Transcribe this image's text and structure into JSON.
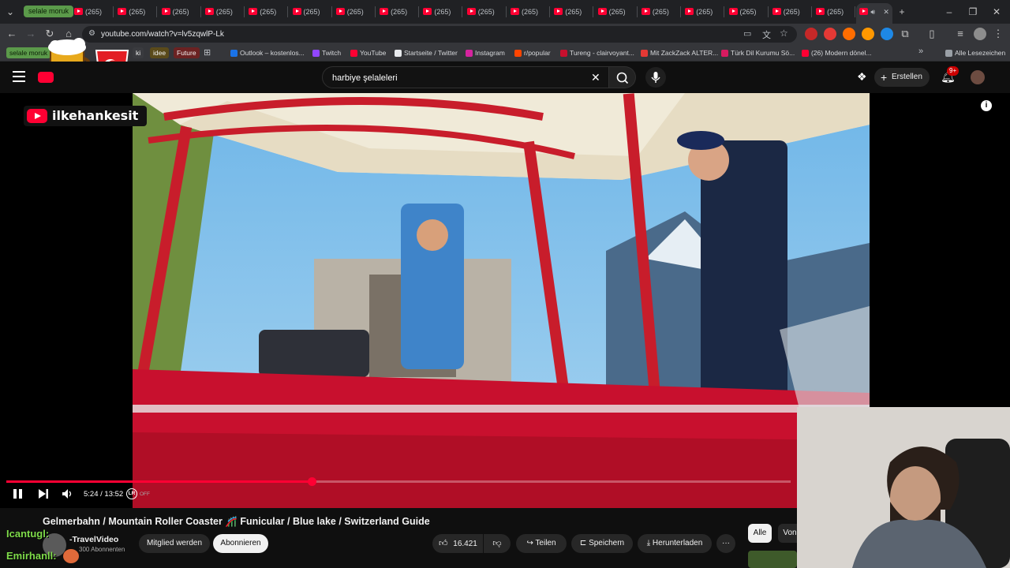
{
  "browser": {
    "tab_group_label": "selale moruk",
    "tabs": [
      {
        "label": "(265)"
      },
      {
        "label": "(265)"
      },
      {
        "label": "(265)"
      },
      {
        "label": "(265)"
      },
      {
        "label": "(265)"
      },
      {
        "label": "(265)"
      },
      {
        "label": "(265)"
      },
      {
        "label": "(265)"
      },
      {
        "label": "(265)"
      },
      {
        "label": "(265)"
      },
      {
        "label": "(265)"
      },
      {
        "label": "(265)"
      },
      {
        "label": "(265)"
      },
      {
        "label": "(265)"
      },
      {
        "label": "(265)"
      },
      {
        "label": "(265)"
      },
      {
        "label": "(265)"
      },
      {
        "label": "(265)"
      }
    ],
    "active_tab_index": 18,
    "url": "youtube.com/watch?v=lv5zqwlP-Lk",
    "bookmarks_group_chip": "selale moruk",
    "bookmark_chips": [
      {
        "label": "ki",
        "color": "#3a3b3f"
      },
      {
        "label": "idee",
        "color": "#5a4a1a"
      },
      {
        "label": "Future",
        "color": "#6b2222"
      }
    ],
    "bookmarks": [
      {
        "label": "Outlook – kostenlos...",
        "color": "#1a73e8"
      },
      {
        "label": "Twitch",
        "color": "#9146ff"
      },
      {
        "label": "YouTube",
        "color": "#ff0033"
      },
      {
        "label": "Startseite / Twitter",
        "color": "#e8eaed"
      },
      {
        "label": "Instagram",
        "color": "#d6249f"
      },
      {
        "label": "r/popular",
        "color": "#ff4500"
      },
      {
        "label": "Tureng - clairvoyant...",
        "color": "#c8102e"
      },
      {
        "label": "Mit ZackZack ALTER...",
        "color": "#e53935"
      },
      {
        "label": "Türk Dil Kurumu Sö...",
        "color": "#d81b60"
      },
      {
        "label": "(26) Modern dönel...",
        "color": "#ff0033"
      }
    ],
    "all_bookmarks": "Alle Lesezeichen"
  },
  "youtube": {
    "search_value": "harbiye şelaleleri",
    "create_label": "Erstellen",
    "notification_badge": "9+",
    "player": {
      "time": "5:24 / 13:52",
      "progress_fraction": 0.389,
      "hd_badge": "LR",
      "off_label": "OFF"
    },
    "video_title": "Gelmerbahn / Mountain Roller Coaster 🎢 Funicular / Blue lake / Switzerland Guide",
    "channel_name": "-TravelVideo",
    "subscribers": "300 Abonnenten",
    "join_label": "Mitglied werden",
    "subscribe_label": "Abonnieren",
    "likes": "16.421",
    "share_label": "Teilen",
    "save_label": "Speichern",
    "download_label": "Herunterladen",
    "more_label": "···",
    "filter_chips": [
      "Alle",
      "Von"
    ]
  },
  "overlay": {
    "channel_tag": "ilkehankesit",
    "chat": [
      {
        "user": "Icantugl",
        "suffix": ":"
      },
      {
        "user": "Emirhanll",
        "suffix": ":"
      }
    ]
  },
  "colors": {
    "accent": "#ff0033",
    "tab_group": "#5b9a4a",
    "chat_name": "#7fdc4a"
  }
}
